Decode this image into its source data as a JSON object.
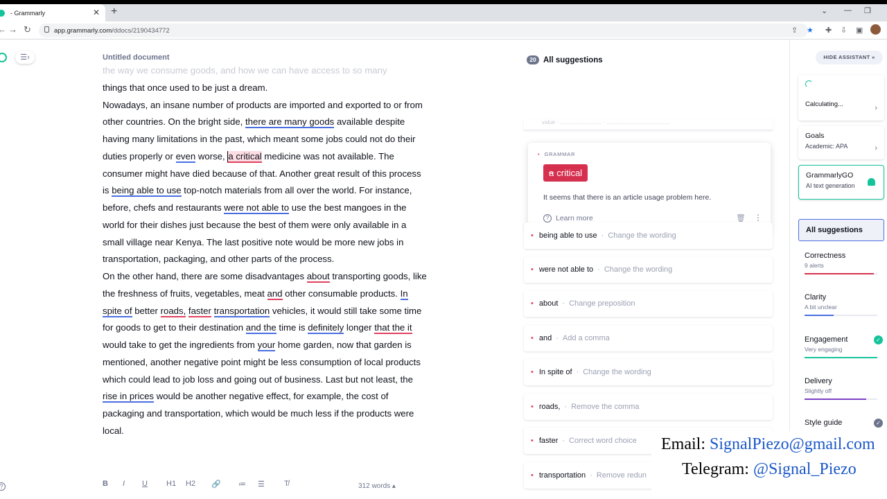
{
  "browser": {
    "tab_title": "- Grammarly",
    "tab_close": "✕",
    "new_tab": "+",
    "url_host": "app.grammarly.com",
    "url_path": "/ddocs/2190434772"
  },
  "editor": {
    "title": "Untitled document",
    "faded_line": "the way we consume goods, and how we can have access to so many",
    "word_count": "312 words ▴",
    "toolbar": [
      "B",
      "I",
      "U",
      "H1",
      "H2",
      "🔗",
      "≔",
      "☰",
      "T̸"
    ]
  },
  "paragraphs": {
    "p0": "things that once used to be just a dream.",
    "p1a": "Nowadays, an insane number of products are imported and exported to or from other countries. On the bright side, ",
    "p1b": "there are many goods",
    "p1c": " available despite having many limitations in the past, which meant some jobs could not do their duties properly or ",
    "p1d": "even",
    "p1e": " worse, ",
    "p1f": "a critical",
    "p1g": " medicine was not available. The consumer might have died because of that. Another great result of this process is ",
    "p1h": "being able to use",
    "p1i": " top-notch materials from all over the world. For instance, before, chefs and restaurants ",
    "p1j": "were not able to",
    "p1k": " use the best mangoes in the world for their dishes just because the best of them were only available in a small village near Kenya. The last positive note would be more new jobs in transportation, packaging, and other parts of the process.",
    "p2a": "On the other hand, there are some disadvantages ",
    "p2b": "about",
    "p2c": " transporting goods, like the freshness of fruits, vegetables, meat ",
    "p2d": "and",
    "p2e": " other consumable products. ",
    "p2f": "In spite of",
    "p2g": " better ",
    "p2h": "roads,",
    "p2i": " ",
    "p2j": "faster",
    "p2k": " ",
    "p2l": "transportation",
    "p2m": " vehicles, it would still take some time for goods to get to their destination ",
    "p2n": "and the",
    "p2o": " time is ",
    "p2p": "definitely",
    "p2q": " longer ",
    "p2r": "that the it",
    "p2s": " would take to get the ingredients from ",
    "p2t": "your",
    "p2u": " home garden, now that garden is mentioned, another negative point might be less consumption of local products which could lead to job loss and going out of business. Last but not least, the ",
    "p2v": "rise in prices",
    "p2w": " would be another negative effect, for example, the cost of packaging and transportation, which would be much less if the products were local."
  },
  "suggestions_panel": {
    "count": "20",
    "heading": "All suggestions",
    "ghost_text": "value  ·  ...........................  ·  .........................................",
    "active": {
      "category": "GRAMMAR",
      "removed": "a",
      "kept": "critical",
      "message": "It seems that there is an article usage problem here.",
      "learn_more": "Learn more"
    },
    "cards": [
      {
        "word": "being able to use",
        "action": "Change the wording"
      },
      {
        "word": "were not able to",
        "action": "Change the wording"
      },
      {
        "word": "about",
        "action": "Change preposition"
      },
      {
        "word": "and",
        "action": "Add a comma"
      },
      {
        "word": "In spite of",
        "action": "Change the wording"
      },
      {
        "word": "roads,",
        "action": "Remove the comma"
      },
      {
        "word": "faster",
        "action": "Correct word choice"
      },
      {
        "word": "transportation",
        "action": "Remove redun"
      }
    ]
  },
  "assistant": {
    "hide_label": "HIDE ASSISTANT  »",
    "score_label": "Calculating...",
    "goals_title": "Goals",
    "goals_sub": "Academic: APA",
    "go_title": "GrammarlyGO",
    "go_sub": "AI text generation",
    "all_suggestions": "All suggestions",
    "metrics": [
      {
        "title": "Correctness",
        "sub": "9 alerts",
        "fill": 0.95,
        "color": "#d6304f"
      },
      {
        "title": "Clarity",
        "sub": "A bit unclear",
        "fill": 0.4,
        "color": "#4a6ee0"
      },
      {
        "title": "Engagement",
        "sub": "Very engaging",
        "fill": 1.0,
        "color": "#15c39a"
      },
      {
        "title": "Delivery",
        "sub": "Slightly off",
        "fill": 0.85,
        "color": "#7b3fc4"
      },
      {
        "title": "Style guide",
        "sub": "",
        "fill": 0,
        "color": "#6d758d"
      }
    ]
  },
  "overlay": {
    "email_label": "Email: ",
    "email": "SignalPiezo@gmail.com",
    "telegram_label": "Telegram: ",
    "telegram": "@Signal_Piezo"
  }
}
